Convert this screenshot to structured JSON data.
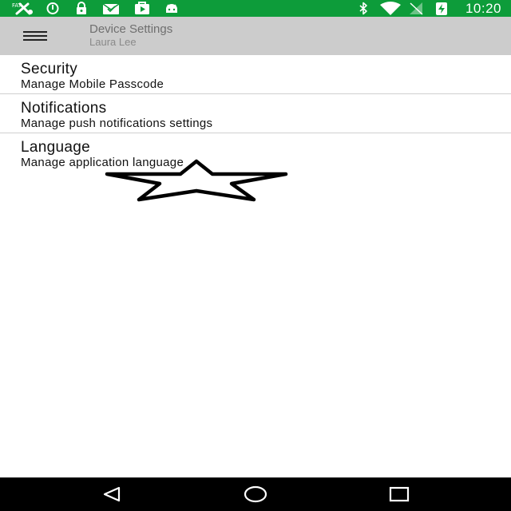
{
  "status_bar": {
    "time": "10:20",
    "left_icons": [
      "tools-icon",
      "alert-circle-icon",
      "lock-icon",
      "mail-icon",
      "play-store-icon",
      "android-icon"
    ],
    "right_icons": [
      "bluetooth-icon",
      "wifi-icon",
      "signal-off-icon",
      "battery-charging-icon"
    ],
    "background_color": "#0d9c3a"
  },
  "app_bar": {
    "title": "Device Settings",
    "subtitle": "Laura Lee",
    "menu_icon": "hamburger-menu-icon",
    "background_color": "#cccccc"
  },
  "settings": {
    "items": [
      {
        "title": "Security",
        "description": "Manage Mobile Passcode"
      },
      {
        "title": "Notifications",
        "description": "Manage push notifications settings"
      },
      {
        "title": "Language",
        "description": "Manage application language"
      }
    ]
  },
  "overlay": {
    "icon": "star-outline-icon"
  },
  "nav_bar": {
    "buttons": [
      "back-triangle-icon",
      "home-circle-icon",
      "recents-square-icon"
    ]
  }
}
